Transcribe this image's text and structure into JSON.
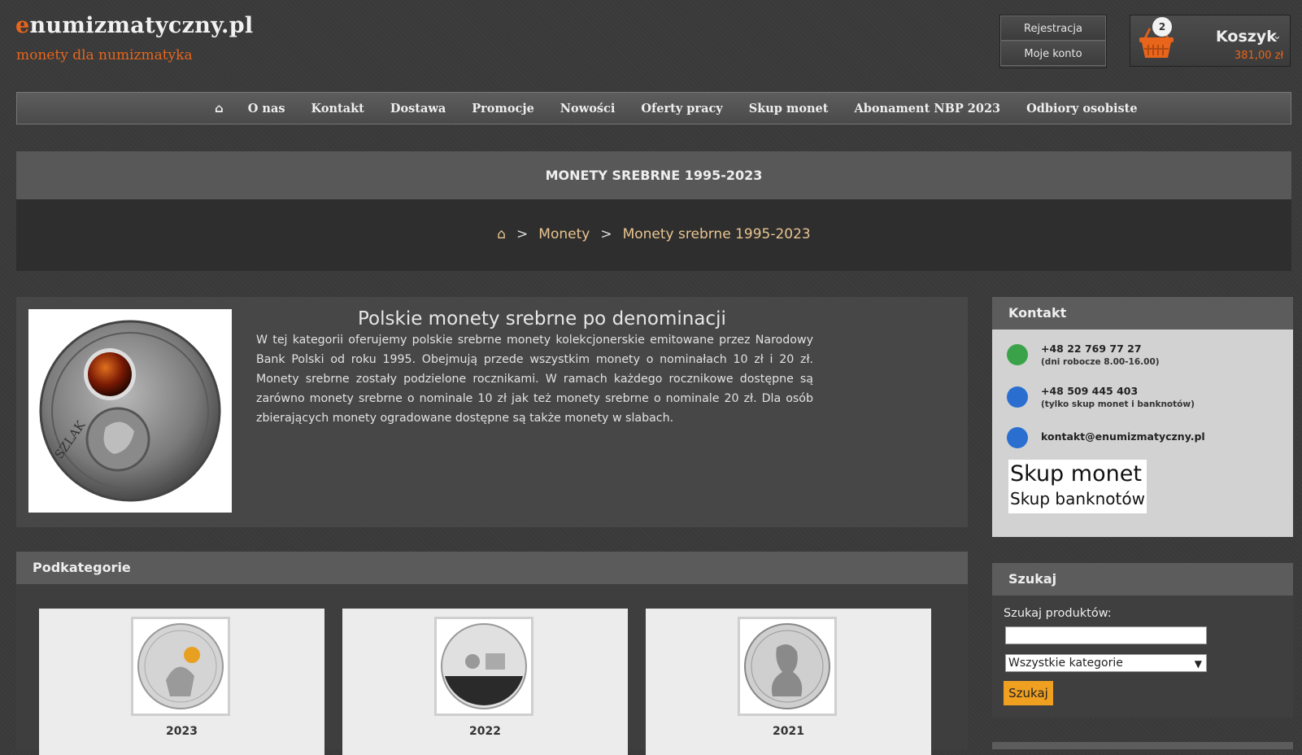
{
  "logo": {
    "first_letter": "e",
    "rest": "numizmatyczny.pl",
    "tagline": "monety dla numizmatyka"
  },
  "account": {
    "register": "Rejestracja",
    "my_account": "Moje konto"
  },
  "cart": {
    "count": "2",
    "label": "Koszyk",
    "total": "381,00 zł"
  },
  "nav": {
    "home_icon": "home-icon",
    "items": [
      "O nas",
      "Kontakt",
      "Dostawa",
      "Promocje",
      "Nowości",
      "Oferty pracy",
      "Skup monet",
      "Abonament NBP 2023",
      "Odbiory osobiste"
    ]
  },
  "page_title": "MONETY SREBRNE 1995-2023",
  "breadcrumb": {
    "sep": ">",
    "items": [
      "Monety",
      "Monety srebrne 1995-2023"
    ]
  },
  "intro": {
    "heading": "Polskie monety srebrne po denominacji",
    "text": "W tej kategorii oferujemy polskie srebrne monety kolekcjonerskie emitowane przez Narodowy Bank Polski od roku 1995. Obejmują przede wszystkim monety o nominałach 10 zł i 20 zł. Monety srebrne zostały podzielone rocznikami. W ramach każdego rocznikowe dostępne są zarówno monety srebrne o nominale 10 zł jak też monety srebrne o nominale 20 zł. Dla osób zbierających monety ogradowane dostępne są także monety w slabach."
  },
  "subcategories": {
    "title": "Podkategorie",
    "items": [
      {
        "year": "2023"
      },
      {
        "year": "2022"
      },
      {
        "year": "2021"
      }
    ]
  },
  "sidebar": {
    "contact": {
      "title": "Kontakt",
      "phone1": "+48 22 769 77 27",
      "phone1_note": "(dni robocze 8.00-16.00)",
      "phone2": "+48 509 445 403",
      "phone2_note": "(tylko skup monet i banknotów)",
      "email": "kontakt@enumizmatyczny.pl",
      "banner_line1": "Skup monet",
      "banner_line2": "Skup banknotów"
    },
    "search": {
      "title": "Szukaj",
      "label": "Szukaj produktów:",
      "input_value": "",
      "category_selected": "Wszystkie kategorie",
      "button": "Szukaj"
    }
  },
  "colors": {
    "accent": "#e8651b",
    "crumb": "#e9c58f",
    "button": "#f0a020"
  }
}
